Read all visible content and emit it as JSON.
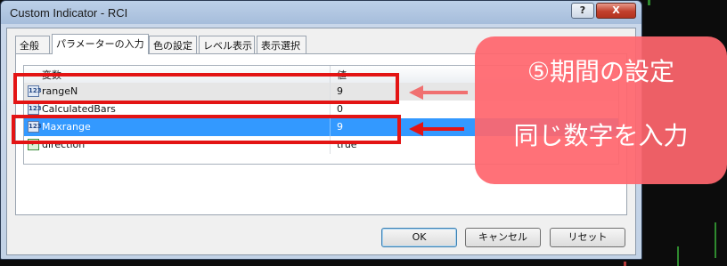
{
  "window": {
    "title": "Custom Indicator - RCI",
    "help_label": "?",
    "close_label": "X"
  },
  "tabs": [
    {
      "label": "全般",
      "active": false
    },
    {
      "label": "パラメーターの入力",
      "active": true
    },
    {
      "label": "色の設定",
      "active": false
    },
    {
      "label": "レベル表示",
      "active": false
    },
    {
      "label": "表示選択",
      "active": false
    }
  ],
  "grid": {
    "columns": [
      "変数",
      "値"
    ],
    "rows": [
      {
        "name": "rangeN",
        "value": "9",
        "icon": "number-icon",
        "state": "highlighted"
      },
      {
        "name": "CalculatedBars",
        "value": "0",
        "icon": "number-icon",
        "state": "normal"
      },
      {
        "name": "Maxrange",
        "value": "9",
        "icon": "number-icon",
        "state": "selected"
      },
      {
        "name": "direction",
        "value": "true",
        "icon": "boolean-icon",
        "state": "normal"
      }
    ]
  },
  "buttons": {
    "ok": "OK",
    "cancel": "キャンセル",
    "reset": "リセット"
  },
  "annotation": {
    "line1": "⑤期間の設定",
    "line2": "同じ数字を入力",
    "box_color": "#e31414",
    "callout_color": "#ff666e",
    "arrow_light_color": "#f07070",
    "arrow_dark_color": "#e31414"
  }
}
